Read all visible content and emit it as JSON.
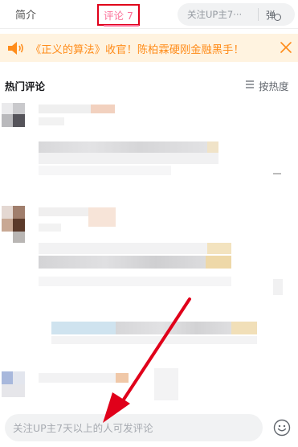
{
  "tabs": {
    "intro_label": "简介",
    "comments_label": "评论 7",
    "active": "comments"
  },
  "danmaku": {
    "placeholder": "关注UP主7···",
    "button_label": "弹"
  },
  "notice": {
    "text": "《正义的算法》收官！陈柏霖硬刚金融黑手！",
    "icon": "speaker-icon",
    "close_icon": "close-icon",
    "color": "#ff8c1a",
    "background": "#fff3e0"
  },
  "comments_header": {
    "title": "热门评论",
    "sort_label": "按热度",
    "sort_icon": "sort-lines-icon"
  },
  "comment_input": {
    "placeholder": "关注UP主7天以上的人可发评论",
    "emoji_icon": "emoji-face-icon"
  },
  "colors": {
    "accent": "#fb7299",
    "annotation": "#e0001a"
  }
}
